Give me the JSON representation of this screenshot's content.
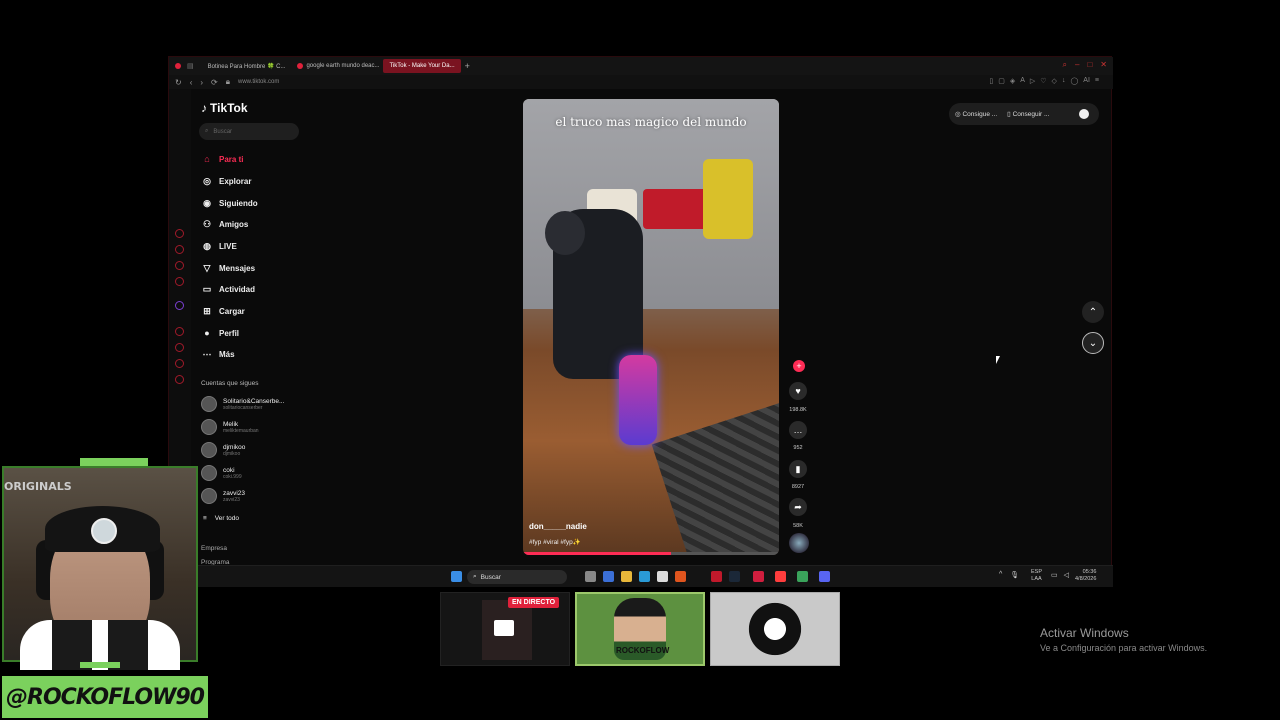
{
  "browser": {
    "tabs": [
      {
        "label": "Botinea Para Hombre 🍀 C..."
      },
      {
        "label": "google earth mundo deac..."
      },
      {
        "label": "TikTok - Make Your Da..."
      }
    ],
    "url": "www.tiktok.com"
  },
  "tiktok": {
    "logo": "TikTok",
    "search_placeholder": "Buscar",
    "nav": [
      {
        "label": "Para ti",
        "icon": "home-icon"
      },
      {
        "label": "Explorar",
        "icon": "compass-icon"
      },
      {
        "label": "Siguiendo",
        "icon": "following-icon"
      },
      {
        "label": "Amigos",
        "icon": "friends-icon"
      },
      {
        "label": "LIVE",
        "icon": "live-icon"
      },
      {
        "label": "Mensajes",
        "icon": "messages-icon"
      },
      {
        "label": "Actividad",
        "icon": "activity-icon"
      },
      {
        "label": "Cargar",
        "icon": "upload-icon"
      },
      {
        "label": "Perfil",
        "icon": "profile-icon"
      },
      {
        "label": "Más",
        "icon": "more-icon"
      }
    ],
    "following_title": "Cuentas que sigues",
    "accounts": [
      {
        "name": "Solitario&Canserbe...",
        "handle": "solitariocanserber"
      },
      {
        "name": "Melik",
        "handle": "meliktemaurban"
      },
      {
        "name": "djmikoo",
        "handle": "djmikoo"
      },
      {
        "name": "coki",
        "handle": "coki.999"
      },
      {
        "name": "zavvi23",
        "handle": "zavvi23"
      }
    ],
    "see_all": "Ver todo",
    "footer": [
      "Empresa",
      "Programa"
    ],
    "video": {
      "caption": "el truco mas magico del mundo",
      "author": "don_____nadie",
      "tags": "#fyp #viral #fyp✨",
      "progress": 0.58
    },
    "actions": {
      "likes": "198.8K",
      "comments": "952",
      "saves": "8927",
      "shares": "58K"
    },
    "top_pill": {
      "item1": "Consigue ...",
      "item2": "Conseguir ..."
    }
  },
  "taskbar": {
    "search": "Buscar",
    "lang": [
      "ESP",
      "LAA"
    ],
    "time": "05:36",
    "date": "4/8/2026"
  },
  "stream": {
    "cam_text": "ORIGINALS",
    "handle": "@ROCKOFLOW90",
    "live_badge": "EN DIRECTO",
    "thumb2_text": "ROCKOFLOW"
  },
  "windows": {
    "activate_title": "Activar Windows",
    "activate_sub": "Ve a Configuración para activar Windows."
  }
}
